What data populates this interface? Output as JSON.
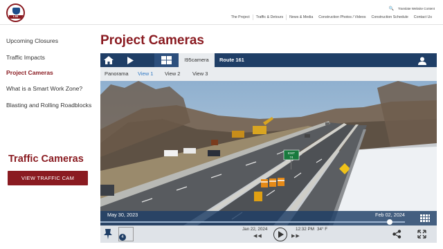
{
  "header": {
    "logo_text": "I-95",
    "translate_label": "Translate Website Content",
    "nav": [
      "The Project",
      "Traffic & Detours",
      "News & Media",
      "Construction Photos / Videos",
      "Construction Schedule",
      "Contact Us"
    ]
  },
  "sidebar": {
    "items": [
      {
        "label": "Upcoming Closures"
      },
      {
        "label": "Traffic Impacts"
      },
      {
        "label": "Project Cameras"
      },
      {
        "label": "What is a Smart Work Zone?"
      },
      {
        "label": "Blasting and Rolling Roadblocks"
      }
    ],
    "traffic_heading": "Traffic Cameras",
    "traffic_button": "VIEW TRAFFIC CAM"
  },
  "main": {
    "title": "Project Cameras",
    "camera_tab": "I95camera",
    "route_tab": "Route 161",
    "view_tabs": [
      "Panorama",
      "View 1",
      "View 2",
      "View 3"
    ],
    "active_view": "View 1"
  },
  "camera": {
    "timeline_start": "May 30, 2023",
    "timeline_end": "Feb 02, 2024",
    "timeline_position": 0.95,
    "current_date": "Jan 22, 2024",
    "current_time": "12:32 PM",
    "temperature": "34° F",
    "layer_count": "4",
    "sign_text_top": "EXIT",
    "sign_text_bottom": "74"
  },
  "colors": {
    "brand_red": "#8a1b21",
    "toolbar_blue": "#1f3e66",
    "active_tab_blue": "#2f78c4"
  }
}
